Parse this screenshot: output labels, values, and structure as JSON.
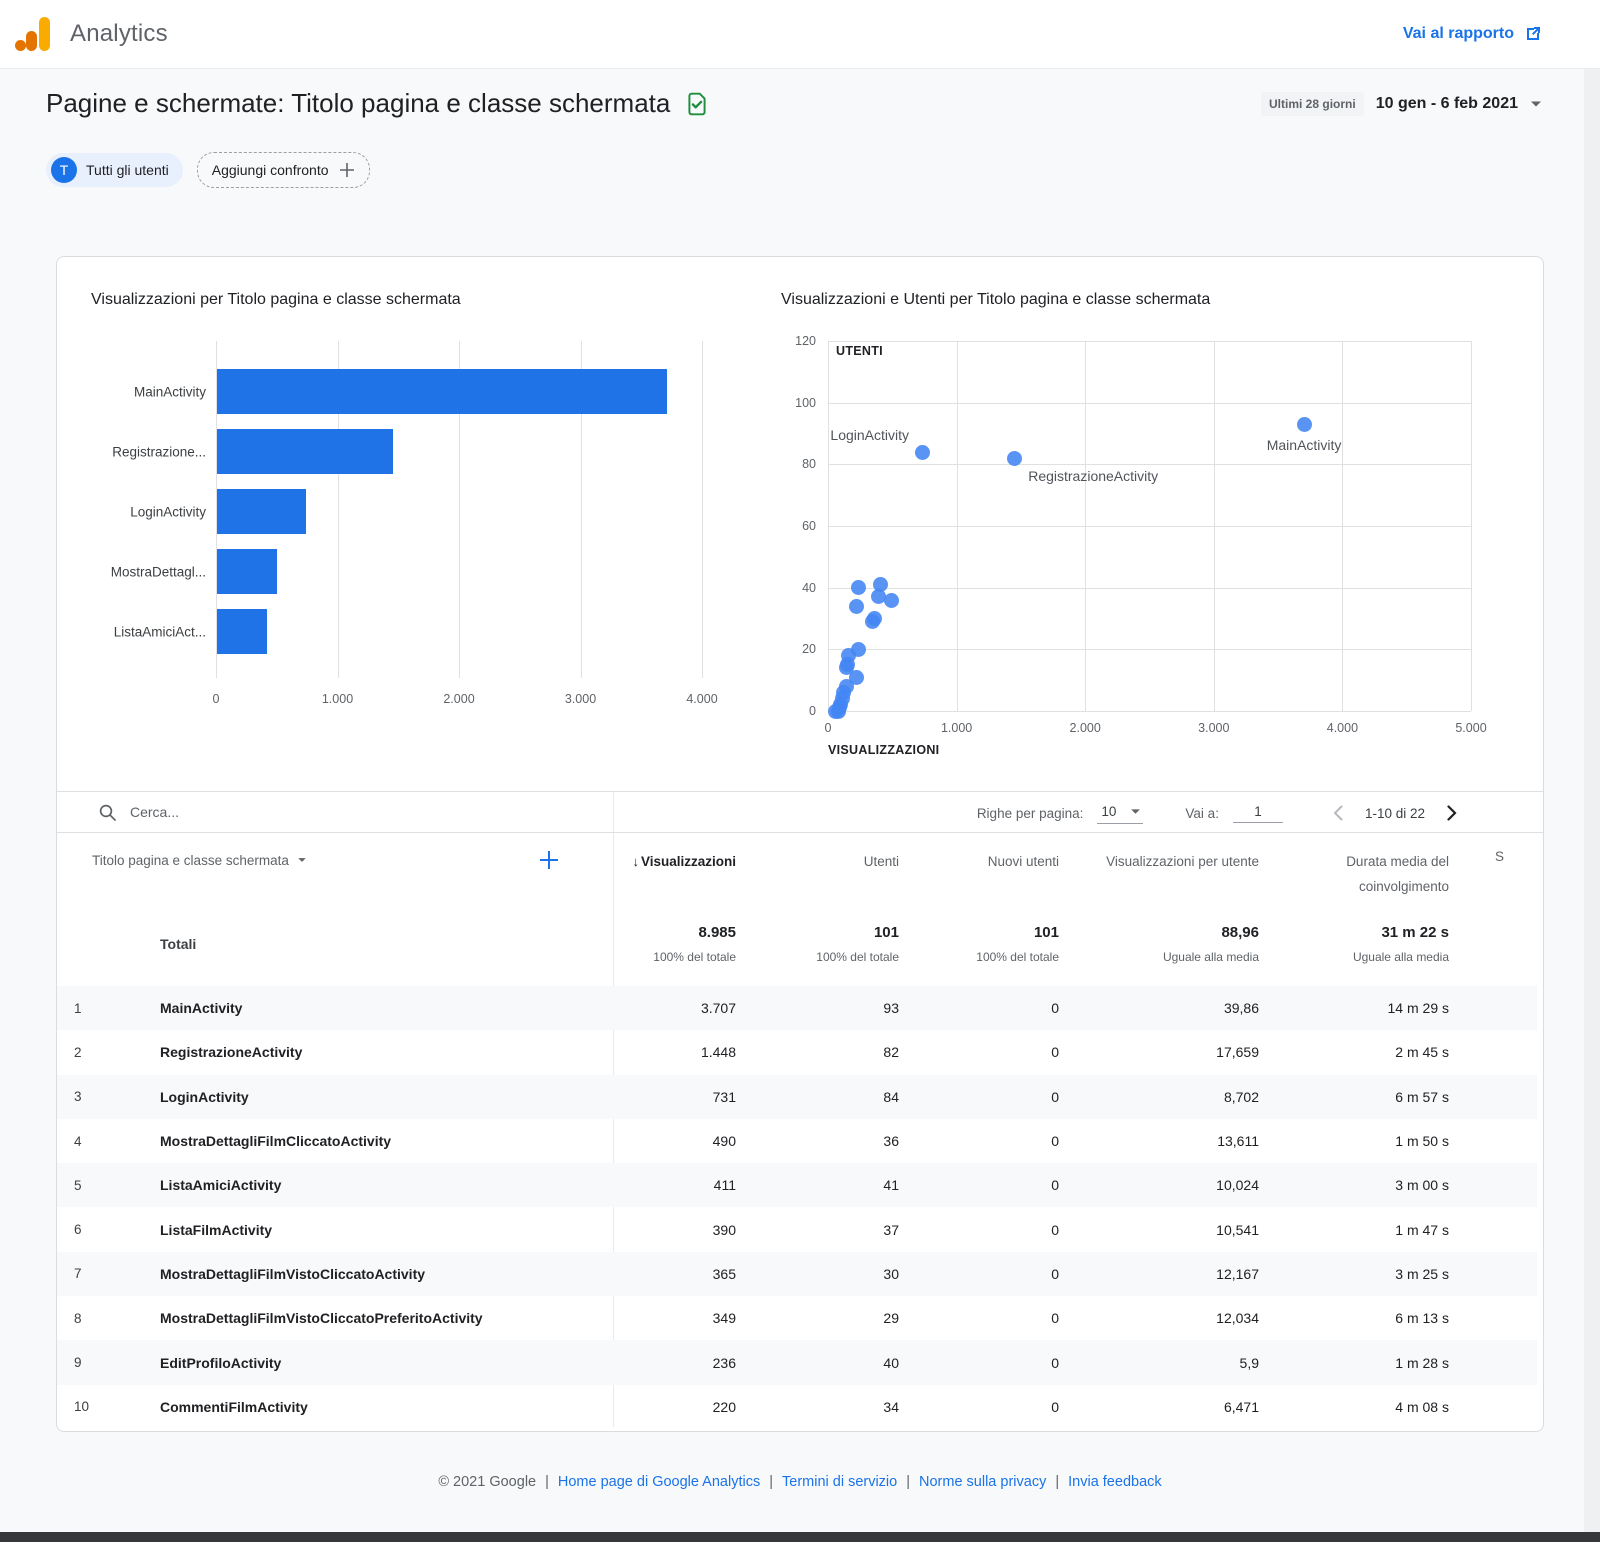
{
  "header": {
    "brand": "Analytics",
    "go_to_report": "Vai al rapporto"
  },
  "page": {
    "title": "Pagine e schermate: Titolo pagina e classe schermata",
    "date_badge": "Ultimi 28 giorni",
    "date_range": "10 gen - 6 feb 2021",
    "chips": {
      "all_users_avatar": "T",
      "all_users": "Tutti gli utenti",
      "add_comparison": "Aggiungi confronto"
    }
  },
  "colors": {
    "accent": "#1a73e8",
    "bar": "#1f73e6",
    "dot": "#4285f4",
    "grid": "#e0e0e0",
    "stripe": "#f8f9fa",
    "green_icon": "#1e8e3e",
    "text": "#202124",
    "secondary_text": "#5f6368"
  },
  "chart_data": [
    {
      "type": "bar",
      "orientation": "horizontal",
      "title": "Visualizzazioni per Titolo pagina e classe schermata",
      "categories": [
        "MainActivity",
        "Registrazione...",
        "LoginActivity",
        "MostraDettagl...",
        "ListaAmiciAct..."
      ],
      "values": [
        3707,
        1448,
        731,
        490,
        411
      ],
      "xlabel": "",
      "ylabel": "",
      "xlim": [
        0,
        4000
      ],
      "x_tick_values": [
        0,
        1000,
        2000,
        3000,
        4000
      ],
      "x_tick_labels": [
        "0",
        "1.000",
        "2.000",
        "3.000",
        "4.000"
      ],
      "grid": true,
      "legend": false
    },
    {
      "type": "scatter",
      "title": "Visualizzazioni e Utenti per Titolo pagina e classe schermata",
      "xlabel": "VISUALIZZAZIONI",
      "ylabel": "UTENTI",
      "xlim": [
        0,
        5000
      ],
      "ylim": [
        0,
        120
      ],
      "x_tick_values": [
        0,
        1000,
        2000,
        3000,
        4000,
        5000
      ],
      "x_tick_labels": [
        "0",
        "1.000",
        "2.000",
        "3.000",
        "4.000",
        "5.000"
      ],
      "y_tick_values": [
        0,
        20,
        40,
        60,
        80,
        100,
        120
      ],
      "y_tick_labels": [
        "0",
        "20",
        "40",
        "60",
        "80",
        "100",
        "120"
      ],
      "grid": true,
      "legend": false,
      "labeled_points": [
        {
          "name": "LoginActivity",
          "x": 731,
          "y": 84,
          "anchor": "left"
        },
        {
          "name": "RegistrazioneActivity",
          "x": 1448,
          "y": 82,
          "anchor": "right"
        },
        {
          "name": "MainActivity",
          "x": 3707,
          "y": 93,
          "anchor": "below"
        }
      ],
      "points": [
        [
          490,
          36
        ],
        [
          411,
          41
        ],
        [
          390,
          37
        ],
        [
          365,
          30
        ],
        [
          349,
          29
        ],
        [
          236,
          40
        ],
        [
          220,
          34
        ],
        [
          240,
          20
        ],
        [
          160,
          18
        ],
        [
          150,
          15
        ],
        [
          145,
          14
        ],
        [
          225,
          11
        ],
        [
          140,
          8
        ],
        [
          120,
          6
        ],
        [
          110,
          4
        ],
        [
          100,
          2
        ],
        [
          90,
          1
        ],
        [
          80,
          0
        ],
        [
          60,
          0
        ]
      ]
    }
  ],
  "table": {
    "search_placeholder": "Cerca...",
    "rows_per_page_label": "Righe per pagina:",
    "rows_per_page_value": "10",
    "goto_label": "Vai a:",
    "goto_value": "1",
    "range_label": "1-10 di 22",
    "dimension_header": "Titolo pagina e classe schermata",
    "columns": [
      "Visualizzazioni",
      "Utenti",
      "Nuovi utenti",
      "Visualizzazioni per utente",
      "Durata media del coinvolgimento"
    ],
    "sorted_column": "Visualizzazioni",
    "clipped_column": "S",
    "totals_label": "Totali",
    "totals": [
      "8.985",
      "101",
      "101",
      "88,96",
      "31 m 22 s"
    ],
    "totals_sub": [
      "100% del totale",
      "100% del totale",
      "100% del totale",
      "Uguale alla media",
      "Uguale alla media"
    ],
    "rows": [
      {
        "n": "1",
        "name": "MainActivity",
        "values": [
          "3.707",
          "93",
          "0",
          "39,86",
          "14 m 29 s"
        ]
      },
      {
        "n": "2",
        "name": "RegistrazioneActivity",
        "values": [
          "1.448",
          "82",
          "0",
          "17,659",
          "2 m 45 s"
        ]
      },
      {
        "n": "3",
        "name": "LoginActivity",
        "values": [
          "731",
          "84",
          "0",
          "8,702",
          "6 m 57 s"
        ]
      },
      {
        "n": "4",
        "name": "MostraDettagliFilmCliccatoActivity",
        "values": [
          "490",
          "36",
          "0",
          "13,611",
          "1 m 50 s"
        ]
      },
      {
        "n": "5",
        "name": "ListaAmiciActivity",
        "values": [
          "411",
          "41",
          "0",
          "10,024",
          "3 m 00 s"
        ]
      },
      {
        "n": "6",
        "name": "ListaFilmActivity",
        "values": [
          "390",
          "37",
          "0",
          "10,541",
          "1 m 47 s"
        ]
      },
      {
        "n": "7",
        "name": "MostraDettagliFilmVistoCliccatoActivity",
        "values": [
          "365",
          "30",
          "0",
          "12,167",
          "3 m 25 s"
        ]
      },
      {
        "n": "8",
        "name": "MostraDettagliFilmVistoCliccatoPreferitoActivity",
        "values": [
          "349",
          "29",
          "0",
          "12,034",
          "6 m 13 s"
        ]
      },
      {
        "n": "9",
        "name": "EditProfiloActivity",
        "values": [
          "236",
          "40",
          "0",
          "5,9",
          "1 m 28 s"
        ]
      },
      {
        "n": "10",
        "name": "CommentiFilmActivity",
        "values": [
          "220",
          "34",
          "0",
          "6,471",
          "4 m 08 s"
        ]
      }
    ]
  },
  "footer": {
    "copyright": "© 2021 Google",
    "separator": "|",
    "links": [
      "Home page di Google Analytics",
      "Termini di servizio",
      "Norme sulla privacy",
      "Invia feedback"
    ]
  }
}
